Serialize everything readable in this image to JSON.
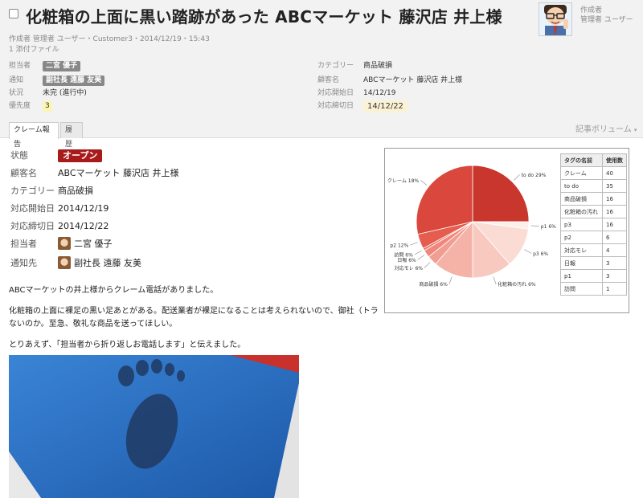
{
  "issue": {
    "title": "化粧箱の上面に黒い踏跡があった ABCマーケット 藤沢店 井上様",
    "meta": "作成者 管理者 ユーザー・Customer3・2014/12/19・15:43",
    "attachments": "1 添付ファイル"
  },
  "author": {
    "caption": "作成者",
    "name": "管理者 ユーザー"
  },
  "fields_left": [
    {
      "label": "担当者",
      "value": "二宮 優子",
      "style": "grey"
    },
    {
      "label": "通知",
      "value": "副社長 遠藤 友美",
      "style": "grey"
    },
    {
      "label": "状況",
      "value": "未完 (進行中)",
      "style": "plain"
    },
    {
      "label": "優先度",
      "value": "3",
      "style": "yellow"
    }
  ],
  "fields_right": [
    {
      "label": "カテゴリー",
      "value": "商品破損",
      "style": "plain"
    },
    {
      "label": "顧客名",
      "value": "ABCマーケット 藤沢店 井上様",
      "style": "plain"
    },
    {
      "label": "対応開始日",
      "value": "14/12/19",
      "style": "plain"
    },
    {
      "label": "対応締切日",
      "value": "14/12/22",
      "style": "cream"
    }
  ],
  "tabs": [
    {
      "label": "クレーム報告",
      "active": true
    },
    {
      "label": "履歴",
      "active": false
    }
  ],
  "volume_label": "記事ボリューム",
  "details": [
    {
      "label": "状態",
      "value": "オープン",
      "kind": "badge"
    },
    {
      "label": "顧客名",
      "value": "ABCマーケット 藤沢店 井上様",
      "kind": "text"
    },
    {
      "label": "カテゴリー",
      "value": "商品破損",
      "kind": "text"
    },
    {
      "label": "対応開始日",
      "value": "2014/12/19",
      "kind": "text"
    },
    {
      "label": "対応締切日",
      "value": "2014/12/22",
      "kind": "text"
    },
    {
      "label": "担当者",
      "value": "二宮 優子",
      "kind": "avatar"
    },
    {
      "label": "通知先",
      "value": "副社長 遠藤 友美",
      "kind": "avatar"
    }
  ],
  "body": {
    "p1": "ABCマーケットの井上様からクレーム電話がありました。",
    "p2a": "化粧箱の上面に裸足の黒い足あとがある。配送業者が裸足になることは考えられないので、御社（トラ",
    "p2b": "ないのか。至急、敬礼な商品を送ってほしい。",
    "p3": "とりあえず、「担当者から折り返しお電話します」と伝えました。"
  },
  "colors": {
    "badge_red": "#a81b1b",
    "tag_grey": "#888888"
  },
  "chart_data": {
    "type": "pie",
    "title": "",
    "slices": [
      {
        "label": "to do 29%",
        "name": "to do",
        "value": 35,
        "color": "#c8362e"
      },
      {
        "label": "p1 6%",
        "name": "p1",
        "value": 3,
        "color": "#fcefe9"
      },
      {
        "label": "p3 6%",
        "name": "p3",
        "value": 16,
        "color": "#fbdcd4"
      },
      {
        "label": "化粧箱の汚れ 6%",
        "name": "化粧箱の汚れ",
        "value": 16,
        "color": "#f8c9bf"
      },
      {
        "label": "商品破損 6%",
        "name": "商品破損",
        "value": 16,
        "color": "#f5b3a8"
      },
      {
        "label": "対応モレ 6%",
        "name": "対応モレ",
        "value": 4,
        "color": "#f29d91"
      },
      {
        "label": "日報 6%",
        "name": "日報",
        "value": 3,
        "color": "#ef877b"
      },
      {
        "label": "訪問 6%",
        "name": "訪問",
        "value": 1,
        "color": "#ec7166"
      },
      {
        "label": "p2 12%",
        "name": "p2",
        "value": 6,
        "color": "#e65d50"
      },
      {
        "label": "クレーム 18%",
        "name": "クレーム",
        "value": 40,
        "color": "#d9473d"
      }
    ],
    "table": {
      "headers": [
        "タグの名前",
        "使用数"
      ],
      "rows": [
        [
          "クレーム",
          "40"
        ],
        [
          "to do",
          "35"
        ],
        [
          "商品破損",
          "16"
        ],
        [
          "化粧箱の汚れ",
          "16"
        ],
        [
          "p3",
          "16"
        ],
        [
          "p2",
          "6"
        ],
        [
          "対応モレ",
          "4"
        ],
        [
          "日報",
          "3"
        ],
        [
          "p1",
          "3"
        ],
        [
          "訪問",
          "1"
        ]
      ]
    }
  }
}
